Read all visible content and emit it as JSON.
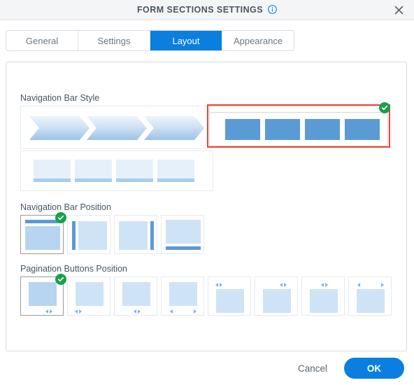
{
  "titlebar": {
    "title": "FORM SECTIONS SETTINGS",
    "info_icon": "info-icon",
    "close_icon": "close-icon"
  },
  "tabs": [
    {
      "label": "General",
      "active": false
    },
    {
      "label": "Settings",
      "active": false
    },
    {
      "label": "Layout",
      "active": true
    },
    {
      "label": "Appearance",
      "active": false
    }
  ],
  "sections": {
    "nav_bar_style": {
      "label": "Navigation Bar Style",
      "options": [
        {
          "name": "chevron-style",
          "selected": false
        },
        {
          "name": "tabs-style",
          "selected": false
        },
        {
          "name": "blocks-style",
          "selected": true
        }
      ]
    },
    "nav_bar_position": {
      "label": "Navigation Bar Position",
      "options": [
        {
          "name": "position-top",
          "selected": true
        },
        {
          "name": "position-left",
          "selected": false
        },
        {
          "name": "position-right",
          "selected": false
        },
        {
          "name": "position-bottom",
          "selected": false
        }
      ]
    },
    "pagination_buttons_position": {
      "label": "Pagination Buttons Position",
      "options": [
        {
          "name": "pagination-bottom-left",
          "selected": true
        },
        {
          "name": "pagination-bottom-left-2",
          "selected": false
        },
        {
          "name": "pagination-bottom-center",
          "selected": false
        },
        {
          "name": "pagination-bottom-spread",
          "selected": false
        },
        {
          "name": "pagination-top-left",
          "selected": false
        },
        {
          "name": "pagination-top-center",
          "selected": false
        },
        {
          "name": "pagination-top-center-2",
          "selected": false
        },
        {
          "name": "pagination-top-spread",
          "selected": false
        }
      ]
    }
  },
  "footer": {
    "cancel_label": "Cancel",
    "ok_label": "OK"
  },
  "colors": {
    "accent_blue": "#0b7fe0",
    "block_blue": "#5b9bd5",
    "selected_red": "#f0413c",
    "check_green": "#18a04a"
  }
}
